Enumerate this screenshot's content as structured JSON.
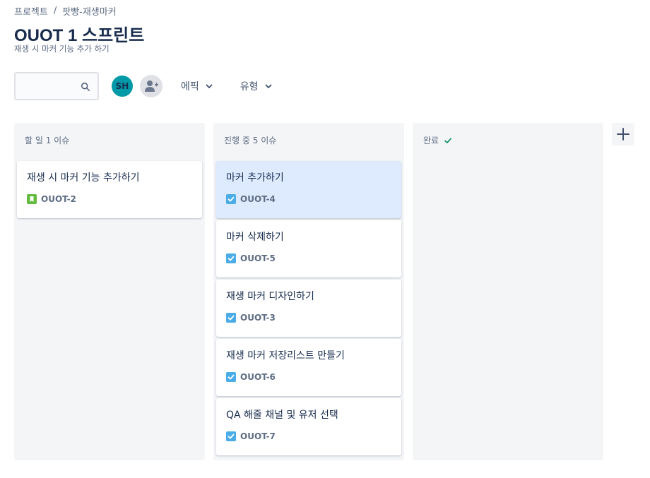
{
  "breadcrumb": {
    "project": "프로젝트",
    "separator": "/",
    "board": "팟빵-재생마커"
  },
  "page": {
    "title": "OUOT 1 스프린트",
    "subtitle": "재생 시 마커 기능 추가 하기"
  },
  "toolbar": {
    "search_value": "",
    "avatar_initials": "SH",
    "epic_label": "에픽",
    "type_label": "유형"
  },
  "columns": [
    {
      "header": "할 일 1 이슈",
      "cards": [
        {
          "title": "재생 시 마커 기능 추가하기",
          "key": "OUOT-2",
          "type": "story"
        }
      ]
    },
    {
      "header": "진행 중 5 이슈",
      "cards": [
        {
          "title": "마커 추가하기",
          "key": "OUOT-4",
          "type": "task",
          "selected": true
        },
        {
          "title": "마커 삭제하기",
          "key": "OUOT-5",
          "type": "task"
        },
        {
          "title": "재생 마커 디자인하기",
          "key": "OUOT-3",
          "type": "task"
        },
        {
          "title": "재생 마커 저장리스트 만들기",
          "key": "OUOT-6",
          "type": "task"
        },
        {
          "title": "QA 해줄 채널 및 유저 선택",
          "key": "OUOT-7",
          "type": "task"
        }
      ]
    },
    {
      "header": "완료",
      "cards": []
    }
  ],
  "colors": {
    "story": "#63ba3c",
    "task": "#4bade8",
    "avatar": "#0099a8",
    "done_check": "#00875a"
  }
}
